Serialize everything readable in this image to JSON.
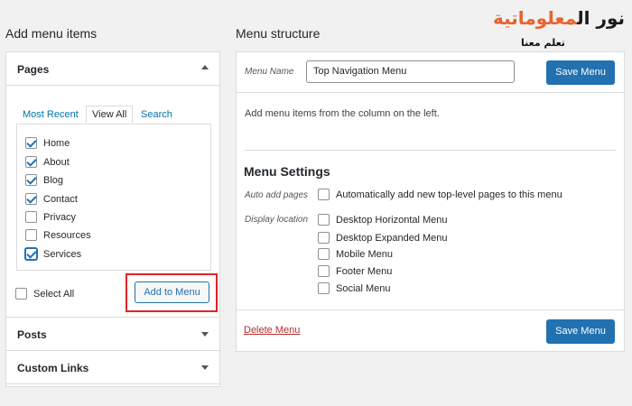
{
  "logo": {
    "part1": "نور ال",
    "part2": "معلو",
    "part3": "ماتية",
    "subtitle": "تعلم معنا",
    "color_dark": "#1a1a1a",
    "color_orange": "#e8622c"
  },
  "left": {
    "heading": "Add menu items",
    "pages": {
      "title": "Pages",
      "tabs": [
        "Most Recent",
        "View All",
        "Search"
      ],
      "items": [
        {
          "label": "Home",
          "checked": true
        },
        {
          "label": "About",
          "checked": true
        },
        {
          "label": "Blog",
          "checked": true
        },
        {
          "label": "Contact",
          "checked": true
        },
        {
          "label": "Privacy",
          "checked": false
        },
        {
          "label": "Resources",
          "checked": false
        },
        {
          "label": "Services",
          "checked": true
        }
      ],
      "select_all": "Select All",
      "add_button": "Add to Menu"
    },
    "posts_title": "Posts",
    "custom_links_title": "Custom Links"
  },
  "right": {
    "heading": "Menu structure",
    "menu_name_label": "Menu Name",
    "menu_name_value": "Top Navigation Menu",
    "save_button": "Save Menu",
    "instructions": "Add menu items from the column on the left.",
    "settings_title": "Menu Settings",
    "auto_add_label": "Auto add pages",
    "auto_add_text": "Automatically add new top-level pages to this menu",
    "display_location_label": "Display location",
    "locations": [
      "Desktop Horizontal Menu",
      "Desktop Expanded Menu",
      "Mobile Menu",
      "Footer Menu",
      "Social Menu"
    ],
    "delete_link": "Delete Menu"
  },
  "colors": {
    "accent": "#2271b1",
    "highlight": "#e02424",
    "danger": "#b32d2e"
  }
}
